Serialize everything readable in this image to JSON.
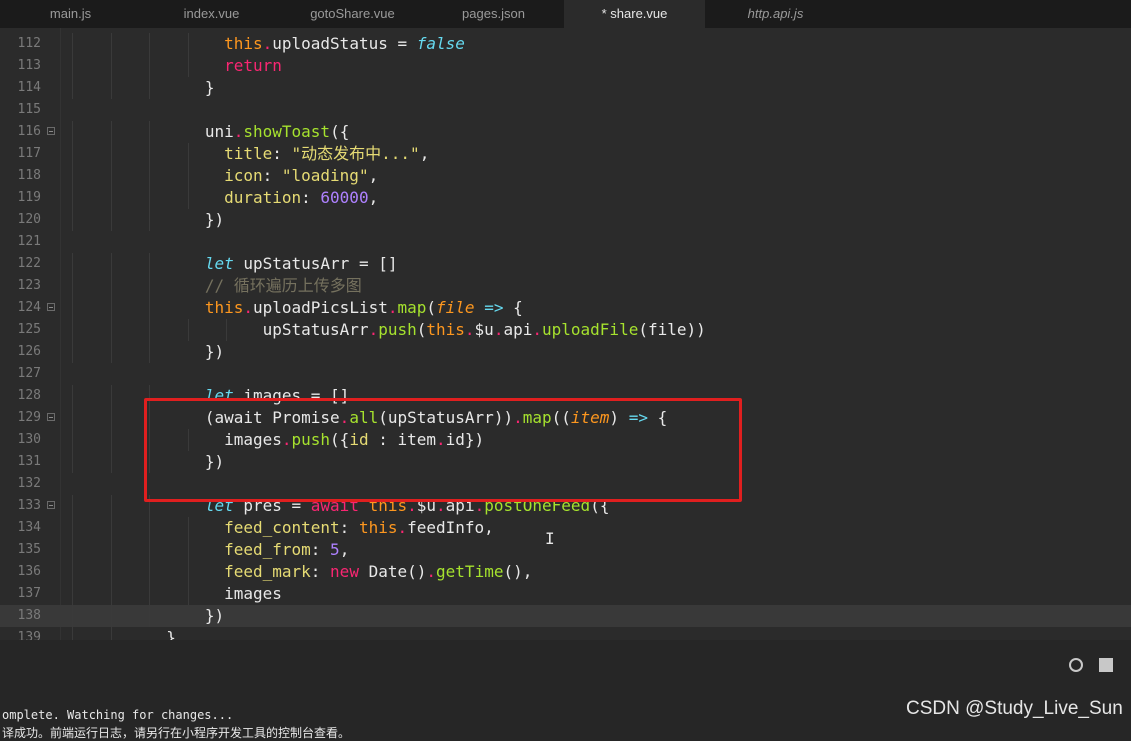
{
  "tabs": [
    {
      "label": "main.js",
      "active": false,
      "italic": false
    },
    {
      "label": "index.vue",
      "active": false,
      "italic": false
    },
    {
      "label": "gotoShare.vue",
      "active": false,
      "italic": false
    },
    {
      "label": "pages.json",
      "active": false,
      "italic": false
    },
    {
      "label": "* share.vue",
      "active": true,
      "italic": false
    },
    {
      "label": "http.api.js",
      "active": false,
      "italic": true
    }
  ],
  "code_lines": [
    {
      "num": "112",
      "indent": 8,
      "fold": false,
      "tokens": [
        [
          "this",
          "this"
        ],
        [
          "dot",
          "."
        ],
        [
          "plain",
          "uploadStatus = "
        ],
        [
          "kwi",
          "false"
        ]
      ]
    },
    {
      "num": "113",
      "indent": 8,
      "fold": false,
      "tokens": [
        [
          "kw",
          "return"
        ]
      ]
    },
    {
      "num": "114",
      "indent": 7,
      "fold": false,
      "tokens": [
        [
          "plain",
          "}"
        ]
      ]
    },
    {
      "num": "115",
      "indent": 0,
      "fold": false,
      "tokens": []
    },
    {
      "num": "116",
      "indent": 7,
      "fold": true,
      "tokens": [
        [
          "plain",
          "uni"
        ],
        [
          "dot",
          "."
        ],
        [
          "fn",
          "showToast"
        ],
        [
          "plain",
          "({"
        ]
      ]
    },
    {
      "num": "117",
      "indent": 8,
      "fold": false,
      "tokens": [
        [
          "prop",
          "title"
        ],
        [
          "plain",
          ": "
        ],
        [
          "str",
          "\"动态发布中...\""
        ],
        [
          "plain",
          ","
        ]
      ]
    },
    {
      "num": "118",
      "indent": 8,
      "fold": false,
      "tokens": [
        [
          "prop",
          "icon"
        ],
        [
          "plain",
          ": "
        ],
        [
          "str",
          "\"loading\""
        ],
        [
          "plain",
          ","
        ]
      ]
    },
    {
      "num": "119",
      "indent": 8,
      "fold": false,
      "tokens": [
        [
          "prop",
          "duration"
        ],
        [
          "plain",
          ": "
        ],
        [
          "num",
          "60000"
        ],
        [
          "plain",
          ","
        ]
      ]
    },
    {
      "num": "120",
      "indent": 7,
      "fold": false,
      "tokens": [
        [
          "plain",
          "})"
        ]
      ]
    },
    {
      "num": "121",
      "indent": 0,
      "fold": false,
      "tokens": []
    },
    {
      "num": "122",
      "indent": 7,
      "fold": false,
      "tokens": [
        [
          "kwi",
          "let"
        ],
        [
          "plain",
          " upStatusArr = []"
        ]
      ]
    },
    {
      "num": "123",
      "indent": 7,
      "fold": false,
      "tokens": [
        [
          "com",
          "// 循环遍历上传多图"
        ]
      ]
    },
    {
      "num": "124",
      "indent": 7,
      "fold": true,
      "tokens": [
        [
          "this",
          "this"
        ],
        [
          "dot",
          "."
        ],
        [
          "plain",
          "uploadPicsList"
        ],
        [
          "dot",
          "."
        ],
        [
          "fn",
          "map"
        ],
        [
          "plain",
          "("
        ],
        [
          "arg",
          "file"
        ],
        [
          "plain",
          " "
        ],
        [
          "arrow",
          "=>"
        ],
        [
          "plain",
          " {"
        ]
      ]
    },
    {
      "num": "125",
      "indent": 10,
      "fold": false,
      "tokens": [
        [
          "plain",
          "upStatusArr"
        ],
        [
          "dot",
          "."
        ],
        [
          "fn",
          "push"
        ],
        [
          "plain",
          "("
        ],
        [
          "this",
          "this"
        ],
        [
          "dot",
          "."
        ],
        [
          "plain",
          "$u"
        ],
        [
          "dot",
          "."
        ],
        [
          "plain",
          "api"
        ],
        [
          "dot",
          "."
        ],
        [
          "fn",
          "uploadFile"
        ],
        [
          "plain",
          "(file))"
        ]
      ]
    },
    {
      "num": "126",
      "indent": 7,
      "fold": false,
      "tokens": [
        [
          "plain",
          "})"
        ]
      ]
    },
    {
      "num": "127",
      "indent": 0,
      "fold": false,
      "tokens": []
    },
    {
      "num": "128",
      "indent": 7,
      "fold": false,
      "tokens": [
        [
          "kwi",
          "let"
        ],
        [
          "plain",
          " images = []"
        ]
      ]
    },
    {
      "num": "129",
      "indent": 7,
      "fold": true,
      "tokens": [
        [
          "plain",
          "(await Promise"
        ],
        [
          "dot",
          "."
        ],
        [
          "fn",
          "all"
        ],
        [
          "plain",
          "(upStatusArr))"
        ],
        [
          "dot",
          "."
        ],
        [
          "fn",
          "map"
        ],
        [
          "plain",
          "(("
        ],
        [
          "arg",
          "item"
        ],
        [
          "plain",
          ") "
        ],
        [
          "arrow",
          "=>"
        ],
        [
          "plain",
          " {"
        ]
      ]
    },
    {
      "num": "130",
      "indent": 8,
      "fold": false,
      "tokens": [
        [
          "plain",
          "images"
        ],
        [
          "dot",
          "."
        ],
        [
          "fn",
          "push"
        ],
        [
          "plain",
          "({"
        ],
        [
          "prop",
          "id"
        ],
        [
          "plain",
          " : item"
        ],
        [
          "dot",
          "."
        ],
        [
          "plain",
          "id})"
        ]
      ]
    },
    {
      "num": "131",
      "indent": 7,
      "fold": false,
      "tokens": [
        [
          "plain",
          "})"
        ]
      ]
    },
    {
      "num": "132",
      "indent": 0,
      "fold": false,
      "tokens": []
    },
    {
      "num": "133",
      "indent": 7,
      "fold": true,
      "tokens": [
        [
          "kwi",
          "let"
        ],
        [
          "plain",
          " pres = "
        ],
        [
          "kw",
          "await"
        ],
        [
          "plain",
          " "
        ],
        [
          "this",
          "this"
        ],
        [
          "dot",
          "."
        ],
        [
          "plain",
          "$u"
        ],
        [
          "dot",
          "."
        ],
        [
          "plain",
          "api"
        ],
        [
          "dot",
          "."
        ],
        [
          "fn",
          "postOneFeed"
        ],
        [
          "plain",
          "({"
        ]
      ]
    },
    {
      "num": "134",
      "indent": 8,
      "fold": false,
      "tokens": [
        [
          "prop",
          "feed_content"
        ],
        [
          "plain",
          ": "
        ],
        [
          "this",
          "this"
        ],
        [
          "dot",
          "."
        ],
        [
          "plain",
          "feedInfo,"
        ]
      ]
    },
    {
      "num": "135",
      "indent": 8,
      "fold": false,
      "tokens": [
        [
          "prop",
          "feed_from"
        ],
        [
          "plain",
          ": "
        ],
        [
          "num",
          "5"
        ],
        [
          "plain",
          ","
        ]
      ]
    },
    {
      "num": "136",
      "indent": 8,
      "fold": false,
      "tokens": [
        [
          "prop",
          "feed_mark"
        ],
        [
          "plain",
          ": "
        ],
        [
          "kw",
          "new"
        ],
        [
          "plain",
          " Date()"
        ],
        [
          "dot",
          "."
        ],
        [
          "fn",
          "getTime"
        ],
        [
          "plain",
          "(),"
        ]
      ]
    },
    {
      "num": "137",
      "indent": 8,
      "fold": false,
      "tokens": [
        [
          "plain",
          "images"
        ]
      ]
    },
    {
      "num": "138",
      "indent": 7,
      "fold": false,
      "current": true,
      "tokens": [
        [
          "plain",
          "})"
        ]
      ]
    },
    {
      "num": "139",
      "indent": 5,
      "fold": false,
      "tokens": [
        [
          "plain",
          "}"
        ]
      ]
    }
  ],
  "console": {
    "line1": "omplete. Watching for changes...",
    "line2": "译成功。前端运行日志，请另行在小程序开发工具的控制台查看。"
  },
  "watermark": "CSDN @Study_Live_Sun",
  "colors": {
    "highlight_box": "#e01f1f",
    "active_tab": "#2b2b2b"
  }
}
